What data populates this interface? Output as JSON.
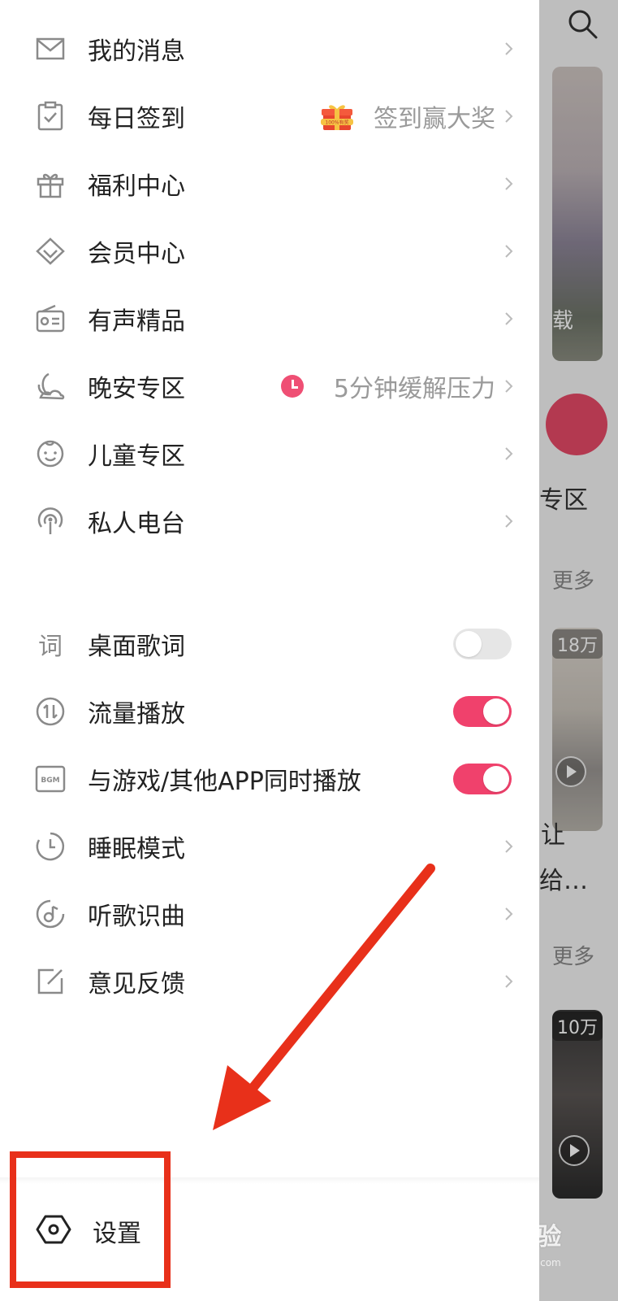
{
  "background": {
    "section_label": "专区",
    "more_1": "更多",
    "more_2": "更多",
    "play_count_1": "18万",
    "play_count_2": "10万",
    "card_text_1": "让",
    "card_text_2": "给…",
    "card_caption": "载"
  },
  "menu_group_1": [
    {
      "name": "my-messages",
      "icon": "mail-icon",
      "label": "我的消息"
    },
    {
      "name": "daily-checkin",
      "icon": "clipboard-check-icon",
      "label": "每日签到",
      "hint": "签到赢大奖",
      "badge_icon": "gift-box-icon"
    },
    {
      "name": "welfare-center",
      "icon": "gift-icon",
      "label": "福利中心"
    },
    {
      "name": "member-center",
      "icon": "diamond-icon",
      "label": "会员中心"
    },
    {
      "name": "audio-premium",
      "icon": "radio-icon",
      "label": "有声精品"
    },
    {
      "name": "goodnight-zone",
      "icon": "moon-icon",
      "label": "晚安专区",
      "hint": "5分钟缓解压力",
      "badge_icon": "clock-icon"
    },
    {
      "name": "kids-zone",
      "icon": "baby-face-icon",
      "label": "儿童专区"
    },
    {
      "name": "private-radio",
      "icon": "broadcast-icon",
      "label": "私人电台"
    }
  ],
  "menu_group_2": [
    {
      "name": "desktop-lyrics",
      "icon": "lyrics-icon",
      "label": "桌面歌词",
      "toggle": "off"
    },
    {
      "name": "data-playback",
      "icon": "data-transfer-icon",
      "label": "流量播放",
      "toggle": "on"
    },
    {
      "name": "play-with-other-apps",
      "icon": "bgm-icon",
      "label": "与游戏/其他APP同时播放",
      "toggle": "on"
    },
    {
      "name": "sleep-mode",
      "icon": "sleep-timer-icon",
      "label": "睡眠模式"
    },
    {
      "name": "song-recognition",
      "icon": "music-recognize-icon",
      "label": "听歌识曲"
    },
    {
      "name": "feedback",
      "icon": "edit-note-icon",
      "label": "意见反馈"
    }
  ],
  "footer": {
    "settings_label": "设置",
    "settings_icon": "hexagon-settings-icon"
  },
  "bgm_icon_text": "BGM",
  "lyrics_icon_text": "词",
  "gift_badge_text": "100%有奖",
  "watermark": {
    "text": "Bai经验",
    "sub": "jingyan.baidu.com"
  },
  "colors": {
    "accent": "#f0416c",
    "annotation": "#e8301a",
    "hint": "#9a9a9a"
  }
}
